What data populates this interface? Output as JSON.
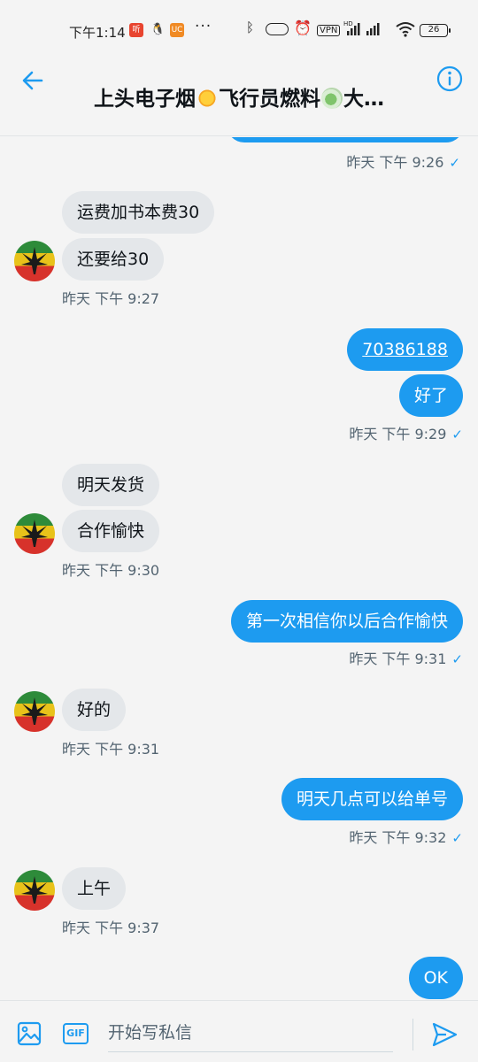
{
  "status_bar": {
    "time": "下午1:14",
    "app_badges": [
      "听",
      "企鹅",
      "UC"
    ],
    "overflow": "···",
    "vpn": "VPN",
    "battery": "26"
  },
  "header": {
    "title_part1": "上头电子烟",
    "title_part2": "飞行员燃料",
    "title_part3": "大…",
    "back_icon": "arrow-left-icon",
    "info_icon": "info-icon"
  },
  "messages": [
    {
      "dir": "out",
      "partial": true,
      "meta": "昨天 下午 9:26"
    },
    {
      "dir": "in",
      "text": "运费加书本费30"
    },
    {
      "dir": "in",
      "text": "还要给30",
      "meta": "昨天 下午 9:27"
    },
    {
      "dir": "out",
      "text": "70386188",
      "link": true
    },
    {
      "dir": "out",
      "text": "好了",
      "meta": "昨天 下午 9:29"
    },
    {
      "dir": "in",
      "text": "明天发货"
    },
    {
      "dir": "in",
      "text": "合作愉快",
      "meta": "昨天 下午 9:30"
    },
    {
      "dir": "out",
      "text": "第一次相信你以后合作愉快",
      "meta": "昨天 下午 9:31"
    },
    {
      "dir": "in",
      "text": "好的",
      "meta": "昨天 下午 9:31"
    },
    {
      "dir": "out",
      "text": "明天几点可以给单号",
      "meta": "昨天 下午 9:32"
    },
    {
      "dir": "in",
      "text": "上午",
      "meta": "昨天 下午 9:37"
    },
    {
      "dir": "out",
      "text": "OK"
    }
  ],
  "composer": {
    "placeholder": "开始写私信",
    "gif_label": "GIF",
    "image_icon": "image-icon",
    "send_icon": "send-icon"
  },
  "colors": {
    "accent": "#1d9bf0",
    "incoming_bubble": "#e4e7ea",
    "meta_text": "#536471"
  }
}
